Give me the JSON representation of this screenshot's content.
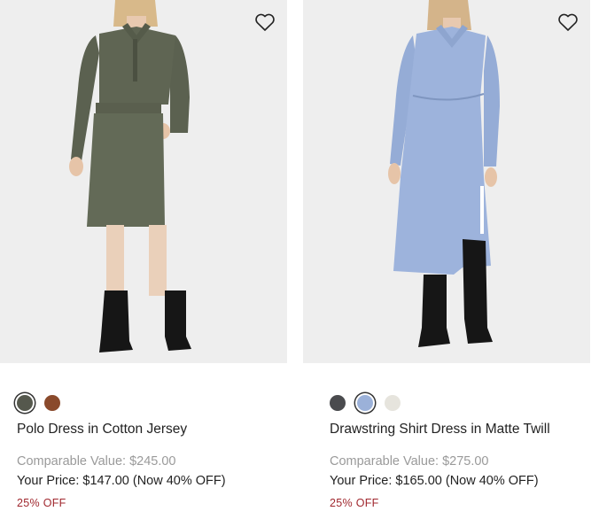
{
  "products": [
    {
      "name": "Polo Dress in Cotton Jersey",
      "comparable_value": "Comparable Value: $245.00",
      "your_price": "Your Price: $147.00 (Now 40% OFF)",
      "discount_badge": "25% OFF",
      "swatches": [
        {
          "color": "#55584d",
          "selected": true
        },
        {
          "color": "#8a4a2c",
          "selected": false
        }
      ],
      "image_icon": "polo-dress-photo",
      "wishlist_icon": "heart-icon"
    },
    {
      "name": "Drawstring Shirt Dress in Matte Twill",
      "comparable_value": "Comparable Value: $275.00",
      "your_price": "Your Price: $165.00 (Now 40% OFF)",
      "discount_badge": "25% OFF",
      "swatches": [
        {
          "color": "#4a4b4e",
          "selected": false
        },
        {
          "color": "#9bb1d9",
          "selected": true
        },
        {
          "color": "#e6e4dd",
          "selected": false
        }
      ],
      "image_icon": "shirt-dress-photo",
      "wishlist_icon": "heart-icon"
    }
  ],
  "colors": {
    "image_bg": "#eeeeee",
    "discount_red": "#a0282f",
    "muted_text": "#9a9a9a"
  }
}
